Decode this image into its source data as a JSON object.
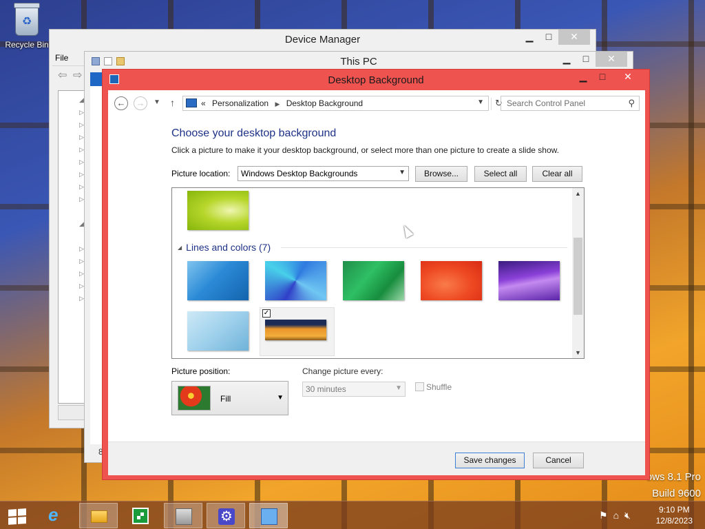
{
  "desktop": {
    "recycle_bin_label": "Recycle Bin",
    "watermark_edition": "ows 8.1 Pro",
    "watermark_build": "Build 9600"
  },
  "device_manager": {
    "title": "Device Manager",
    "menu_file": "File"
  },
  "this_pc": {
    "title": "This PC",
    "status_text": "8"
  },
  "window": {
    "title": "Desktop Background",
    "title_color": "#ef5350",
    "controls": {
      "minimize": "▁",
      "maximize": "□",
      "close": "✕"
    }
  },
  "address": {
    "prefix": "«",
    "crumbs": [
      "Personalization",
      "Desktop Background"
    ],
    "separator": "▶",
    "search_placeholder": "Search Control Panel"
  },
  "content": {
    "heading": "Choose your desktop background",
    "subtext": "Click a picture to make it your desktop background, or select more than one picture to create a slide show.",
    "picture_location_label": "Picture location:",
    "picture_location_value": "Windows Desktop Backgrounds",
    "browse_label": "Browse...",
    "select_all_label": "Select all",
    "clear_all_label": "Clear all"
  },
  "gallery": {
    "group_title": "Lines and colors (7)",
    "selected_thumbnail": "orange-city-skyline",
    "selected_checkmark": "✓",
    "thumbnails": [
      "green-leaves",
      "blue-lines",
      "blue-polygons",
      "green-wave",
      "red-swirl",
      "purple-layers",
      "light-blue-curve",
      "orange-city-skyline"
    ]
  },
  "options": {
    "picture_position_label": "Picture position:",
    "picture_position_value": "Fill",
    "change_every_label": "Change picture every:",
    "change_every_value": "30 minutes",
    "shuffle_label": "Shuffle",
    "shuffle_checked": false
  },
  "footer": {
    "save_label": "Save changes",
    "cancel_label": "Cancel"
  },
  "taskbar": {
    "apps": [
      "start",
      "internet-explorer",
      "file-explorer",
      "store",
      "device-manager",
      "control-panel",
      "display-settings"
    ],
    "active_app": "display-settings",
    "clock_time": "9:10 PM",
    "clock_date": "12/8/2023"
  }
}
